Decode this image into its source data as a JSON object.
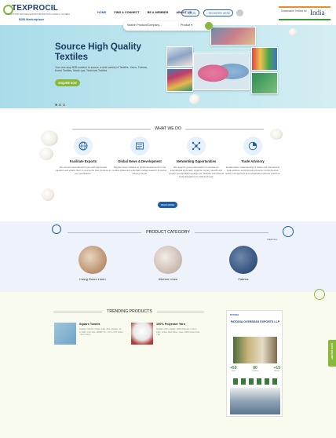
{
  "header": {
    "logo_text": "TEXPROCIL",
    "logo_tagline": "THE COTTON TEXTILES EXPORT PROMOTION COUNCIL OF INDIA",
    "logo_sub": "B2B Marketplace",
    "nav": [
      "HOME",
      "FIND A CONNECT",
      "BE A MEMBER",
      "ABOUT US"
    ],
    "login_label": "LOGIN",
    "register_label": "REGISTER HERE",
    "partner_small": "Sustainable Textiles for",
    "partner_big": "India"
  },
  "search": {
    "placeholder": "Search Product/Company...",
    "select_value": "Product"
  },
  "hero": {
    "title": "Source High Quality Textiles",
    "text": "Your one-stop B2B solution to source a wide variety of Textiles- Yarns, Fabrics, Home Textiles, Made-ups, Technical Textiles",
    "cta": "ENQUIRE NOW",
    "slide_count": 3,
    "active_slide": 1
  },
  "what_we_do": {
    "title": "WHAT WE DO",
    "items": [
      {
        "title": "Facilitate Exports",
        "icon": "globe-icon",
        "text": "We connect international buyers with appropriate suppliers and enable them to source the best products as per specification."
      },
      {
        "title": "Global News & Development",
        "icon": "news-icon",
        "text": "Regular timely updates on global developments in the textiles space and undertake market research & intel for industry trends."
      },
      {
        "title": "Networking Opportunities",
        "icon": "network-icon",
        "text": "We organize group participation of members in international trade fairs, organize country specific and product specific B2B meetings etc. facilitate international trade delegations to India & abroad."
      },
      {
        "title": "Trade Advisory",
        "icon": "chart-pie-icon",
        "text": "Enable better understanding of Indian and international trade policies, sectoral and economic comprehensive, quality management and sustainable business practices."
      }
    ],
    "read_more": "READ MORE"
  },
  "product_category": {
    "title": "PRODUCT CATEGORY",
    "view_all": "VIEW ALL",
    "items": [
      "Living Room Linen",
      "Kitchen Linen",
      "Fabrics"
    ]
  },
  "trending": {
    "title": "TRENDING PRODUCTS",
    "products": [
      {
        "name": "Square Towels",
        "desc": "Supplier: XXXXX • Origin: India • Min. Quantity: 10 to 1000 • Unit: Nos • MRRP: XX ~ XXX • XXX Colour • Terry Cotton"
      },
      {
        "name": "100% Polyester Yarn",
        "desc": "Supplier: XXX • Quality: 100% Polyester • Count: 1/20 • Colour: Raw White • Uses: 100% Cotton Knits • Vat"
      }
    ],
    "banner": {
      "brand": "PATODIA",
      "title": "PATODIA OVERSEAS EXPORTS LLP",
      "stats": [
        {
          "value": "+50",
          "label": "Years"
        },
        {
          "value": "80",
          "label": "Countries"
        },
        {
          "value": "+15",
          "label": "Awards"
        }
      ]
    }
  },
  "side_tab_label": "QUICK ENQUIRY",
  "colors": {
    "brand_blue": "#1f5fa6",
    "brand_green": "#8ab83a",
    "hero_bg": "#bfe6ef"
  }
}
